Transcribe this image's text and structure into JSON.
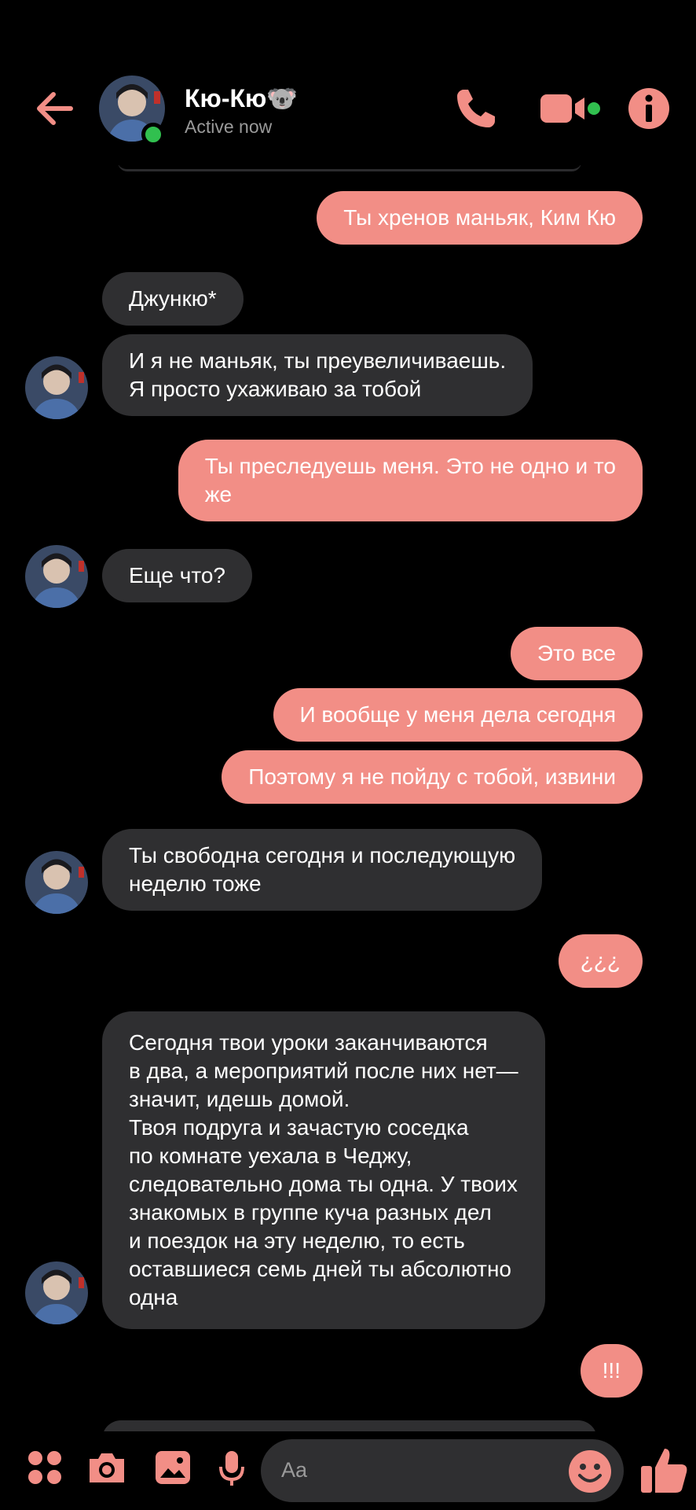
{
  "header": {
    "contact_name": "Кю-Кю🐨",
    "status": "Active now"
  },
  "messages": [
    {
      "side": "sent",
      "text": "Ты хренов маньяк, Ким Кю"
    },
    {
      "side": "received",
      "text": "Джункю*"
    },
    {
      "side": "received",
      "text": "И я не маньяк, ты преувеличиваешь.\nЯ просто ухаживаю за тобой"
    },
    {
      "side": "sent",
      "text": "Ты преследуешь меня. Это не одно и то\nже"
    },
    {
      "side": "received",
      "text": "Еще что?"
    },
    {
      "side": "sent",
      "text": "Это все"
    },
    {
      "side": "sent",
      "text": "И вообще у меня дела сегодня"
    },
    {
      "side": "sent",
      "text": "Поэтому я не пойду с тобой, извини"
    },
    {
      "side": "received",
      "text": "Ты свободна сегодня и последующую\nнеделю тоже"
    },
    {
      "side": "sent",
      "text": "¿¿¿"
    },
    {
      "side": "received",
      "text": "Сегодня твои уроки заканчиваются\nв два, а мероприятий после них нет—\nзначит, идешь домой.\nТвоя подруга и зачастую соседка\nпо комнате уехала в Чеджу,\nследовательно дома ты одна. У твоих\nзнакомых в группе куча разных дел\nи поездок на эту неделю, то есть\nоставшиеся семь дней ты абсолютно\nодна"
    },
    {
      "side": "sent",
      "text": "!!!"
    }
  ],
  "composer": {
    "placeholder": "Aa"
  },
  "colors": {
    "accent": "#f28e86",
    "received_bubble": "#2f2f31",
    "online": "#31c04f",
    "background": "#000000"
  },
  "icons": [
    "back-arrow-icon",
    "phone-icon",
    "video-camera-icon",
    "info-icon",
    "apps-grid-icon",
    "camera-icon",
    "gallery-icon",
    "microphone-icon",
    "emoji-icon",
    "thumbs-up-icon"
  ]
}
